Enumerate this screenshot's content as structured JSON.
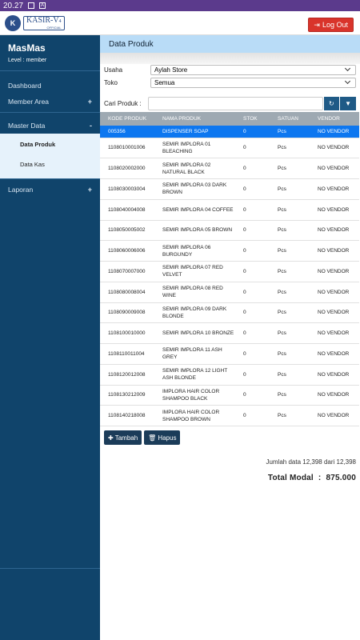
{
  "statusbar": {
    "time": "20.27"
  },
  "app": {
    "logo_text": "KASIR-V",
    "logo_version": "4",
    "logo_sub": "OFFICIAL",
    "logout_label": "Log Out"
  },
  "sidebar": {
    "username": "MasMas",
    "level": "Level : member",
    "items": [
      {
        "label": "Dashboard"
      },
      {
        "label": "Member Area",
        "toggle": "+"
      },
      {
        "label": "Master Data",
        "toggle": "-"
      },
      {
        "label": "Laporan",
        "toggle": "+"
      }
    ],
    "submenu": [
      {
        "label": "Data Produk"
      },
      {
        "label": "Data Kas"
      }
    ]
  },
  "page": {
    "title": "Data Produk"
  },
  "filters": {
    "usaha_label": "Usaha",
    "usaha_value": "Aylah Store",
    "toko_label": "Toko",
    "toko_value": "Semua",
    "search_label": "Cari Produk :",
    "search_value": ""
  },
  "table": {
    "headers": [
      "KODE PRODUK",
      "NAMA PRODUK",
      "STOK",
      "SATUAN",
      "VENDOR"
    ],
    "rows": [
      {
        "kode": "005356",
        "nama": "DISPENSER SOAP",
        "stok": "0",
        "satuan": "Pcs",
        "vendor": "NO VENDOR"
      },
      {
        "kode": "1108010001006",
        "nama": "SEMIR IMPLORA 01 BLEACHING",
        "stok": "0",
        "satuan": "Pcs",
        "vendor": "NO VENDOR"
      },
      {
        "kode": "1108020002000",
        "nama": "SEMIR IMPLORA 02 NATURAL BLACK",
        "stok": "0",
        "satuan": "Pcs",
        "vendor": "NO VENDOR"
      },
      {
        "kode": "1108030003004",
        "nama": "SEMIR IMPLORA 03 DARK BROWN",
        "stok": "0",
        "satuan": "Pcs",
        "vendor": "NO VENDOR"
      },
      {
        "kode": "1108040004008",
        "nama": "SEMIR IMPLORA 04 COFFEE",
        "stok": "0",
        "satuan": "Pcs",
        "vendor": "NO VENDOR"
      },
      {
        "kode": "1108050005002",
        "nama": "SEMIR IMPLORA 05 BROWN",
        "stok": "0",
        "satuan": "Pcs",
        "vendor": "NO VENDOR"
      },
      {
        "kode": "1108060006006",
        "nama": "SEMIR IMPLORA 06 BURGUNDY",
        "stok": "0",
        "satuan": "Pcs",
        "vendor": "NO VENDOR"
      },
      {
        "kode": "1108070007000",
        "nama": "SEMIR IMPLORA 07 RED VELVET",
        "stok": "0",
        "satuan": "Pcs",
        "vendor": "NO VENDOR"
      },
      {
        "kode": "1108080008004",
        "nama": "SEMIR IMPLORA 08 RED WINE",
        "stok": "0",
        "satuan": "Pcs",
        "vendor": "NO VENDOR"
      },
      {
        "kode": "1108090009008",
        "nama": "SEMIR IMPLORA 09 DARK BLONDE",
        "stok": "0",
        "satuan": "Pcs",
        "vendor": "NO VENDOR"
      },
      {
        "kode": "1108100010000",
        "nama": "SEMIR IMPLORA 10 BRONZE",
        "stok": "0",
        "satuan": "Pcs",
        "vendor": "NO VENDOR"
      },
      {
        "kode": "1108110011004",
        "nama": "SEMIR IMPLORA 11 ASH GREY",
        "stok": "0",
        "satuan": "Pcs",
        "vendor": "NO VENDOR"
      },
      {
        "kode": "1108120012008",
        "nama": "SEMIR IMPLORA 12 LIGHT ASH BLONDE",
        "stok": "0",
        "satuan": "Pcs",
        "vendor": "NO VENDOR"
      },
      {
        "kode": "1108130212009",
        "nama": "IMPLORA HAIR COLOR SHAMPOO BLACK",
        "stok": "0",
        "satuan": "Pcs",
        "vendor": "NO VENDOR"
      },
      {
        "kode": "1108140218008",
        "nama": "IMPLORA HAIR COLOR SHAMPOO BROWN",
        "stok": "0",
        "satuan": "Pcs",
        "vendor": "NO VENDOR"
      }
    ]
  },
  "actions": {
    "tambah_label": "Tambah",
    "hapus_label": "Hapus"
  },
  "summary": {
    "jumlah_text": "Jumlah data 12,398 dari 12,398",
    "total_label": "Total Modal",
    "total_sep": ":",
    "total_value": "875.000"
  },
  "colors": {
    "sidebar": "#10446b",
    "header_bar": "#b9dcf7",
    "selected_row": "#0d77f0",
    "logout": "#d9342b"
  }
}
